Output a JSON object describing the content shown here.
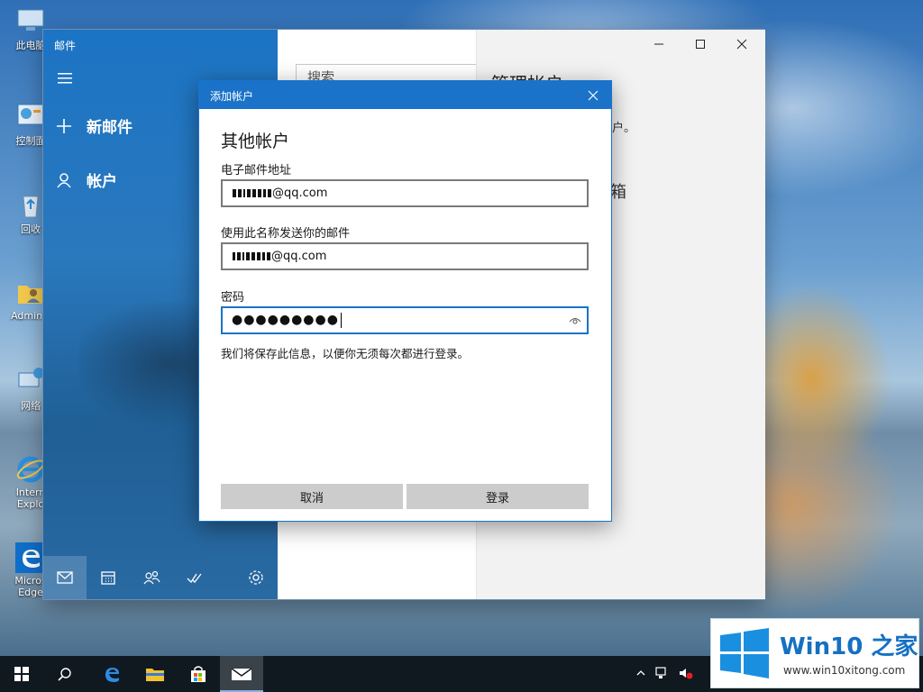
{
  "desktop": {
    "icons": [
      {
        "label": "此电脑"
      },
      {
        "label": "控制面"
      },
      {
        "label": "回收"
      },
      {
        "label": "Adminis"
      },
      {
        "label": "网络"
      },
      {
        "label": "Intern Explo"
      },
      {
        "label": "Micros Edge"
      }
    ]
  },
  "mail": {
    "app_title": "邮件",
    "nav": {
      "new_mail": "新邮件",
      "accounts": "帐户"
    },
    "search_placeholder": "搜索",
    "right_pane": {
      "title": "管理帐户",
      "hint_fragment": "户。",
      "inbox_fragment": "箱"
    }
  },
  "dialog": {
    "title": "添加帐户",
    "heading": "其他帐户",
    "email_label": "电子邮件地址",
    "email_value_suffix": "@qq.com",
    "sender_label": "使用此名称发送你的邮件",
    "sender_value_suffix": "@qq.com",
    "password_label": "密码",
    "password_value": "●●●●●●●●●",
    "save_note": "我们将保存此信息，以便你无须每次都进行登录。",
    "cancel_label": "取消",
    "signin_label": "登录"
  },
  "watermark": {
    "title": "Win10 之家",
    "url": "www.win10xitong.com"
  },
  "colors": {
    "accent": "#1a73c9",
    "sidebar": "#1c74c4",
    "button_gray": "#cccccc",
    "taskbar": "#101820"
  }
}
